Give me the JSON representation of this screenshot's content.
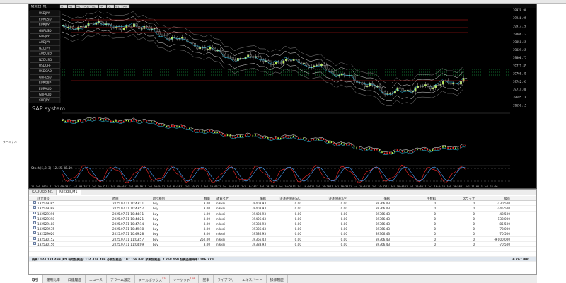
{
  "chart": {
    "window_title": "NIKKEI,M1",
    "toolbar_labels": [
      "M1",
      "M5",
      "M15",
      "M30",
      "H1",
      "H4",
      "D1",
      "W1",
      "MN"
    ],
    "symbols": [
      "USDJPY",
      "EURUSD",
      "EURJPY",
      "GBPUSD",
      "GBPJPY",
      "AUDJPY",
      "NZDJPY",
      "AUDUSD",
      "NZDUSD",
      "USDCHF",
      "USDCAD",
      "GBPUSD",
      "EURGBP",
      "EURAUD",
      "GBPAUD",
      "CHFJPY"
    ],
    "watermark": "SAP system",
    "price_labels": [
      "39970.90",
      "39946.95",
      "39917.20",
      "39886.12",
      "39858.55",
      "39829.65",
      "39800.75",
      "39771.85",
      "39760.45",
      "39742.93",
      "39714.00",
      "39685.10",
      "39656.15"
    ],
    "time_labels": [
      "11 Jul 2025",
      "11 Jul 09:34",
      "11 Jul 09:38",
      "11 Jul 09:42",
      "11 Jul 09:46",
      "11 Jul 09:50",
      "11 Jul 09:54",
      "11 Jul 09:58",
      "11 Jul 10:02",
      "11 Jul 10:06",
      "11 Jul 10:10",
      "11 Jul 10:14",
      "11 Jul 10:18",
      "11 Jul 10:22",
      "11 Jul 10:26",
      "11 Jul 10:30",
      "11 Jul 10:34",
      "11 Jul 10:38",
      "11 Jul 10:42",
      "11 Jul 10:46",
      "11 Jul 10:50",
      "11 Jul 10:54",
      "11 Jul 10:58",
      "11 Jul 11:02",
      "11 Jul 11:06"
    ],
    "stoch_label": "Stoch(5,3,3) 12.55 38.00"
  },
  "colors": {
    "bull": "#b6f04c",
    "bear": "#1a1a1a",
    "red_line": "#d21a1a",
    "green_dots": "#1fd15a",
    "cyan": "#33d8ff",
    "white_line": "#ffffff",
    "stoch_red": "#ff2a2a",
    "stoch_blue": "#4aa3ff"
  },
  "terminal": {
    "symbol_tabs": [
      "SAUUSD,M1",
      "NIKKEI,M1"
    ],
    "headers": [
      "注文番号",
      "時間",
      "取引種別",
      "数量",
      "通貨ペア",
      "価格",
      "決済逆指値(S/L)",
      "決済指値(T/P)",
      "価格",
      "手数料",
      "スワップ",
      "損益"
    ],
    "orders": [
      {
        "id": "132529385",
        "time": "2025.07.11 10:43:11",
        "type": "buy",
        "qty": "3.00",
        "symbol": "nikkei",
        "price": "39408.93",
        "sl": "0.00",
        "tp": "0.00",
        "cur": "39366.43",
        "fee": "0",
        "swap": "0",
        "profit": "-130 500"
      },
      {
        "id": "132529388",
        "time": "2025.07.11 10:43:52",
        "type": "buy",
        "qty": "3.00",
        "symbol": "nikkei",
        "price": "39408.93",
        "sl": "0.00",
        "tp": "0.00",
        "cur": "39366.43",
        "fee": "0",
        "swap": "0",
        "profit": "-145 500"
      },
      {
        "id": "132529396",
        "time": "2025.07.11 10:44:11",
        "type": "buy",
        "qty": "1.00",
        "symbol": "nikkei",
        "price": "39408.93",
        "sl": "0.00",
        "tp": "0.00",
        "cur": "39366.43",
        "fee": "0",
        "swap": "0",
        "profit": "-48 500"
      },
      {
        "id": "132529398",
        "time": "2025.07.11 10:44:21",
        "type": "buy",
        "qty": "3.00",
        "symbol": "nikkei",
        "price": "39406.43",
        "sl": "0.00",
        "tp": "0.00",
        "cur": "39366.43",
        "fee": "0",
        "swap": "0",
        "profit": "-138 000"
      },
      {
        "id": "132529488",
        "time": "2025.07.11 10:47:14",
        "type": "buy",
        "qty": "3.00",
        "symbol": "nikkei",
        "price": "39388.93",
        "sl": "0.00",
        "tp": "0.00",
        "cur": "39366.43",
        "fee": "0",
        "swap": "0",
        "profit": "-85 500"
      },
      {
        "id": "132529535",
        "time": "2025.07.11 10:49:18",
        "type": "buy",
        "qty": "3.00",
        "symbol": "nikkei",
        "price": "39386.43",
        "sl": "0.00",
        "tp": "0.00",
        "cur": "39366.43",
        "fee": "0",
        "swap": "0",
        "profit": "-78 000"
      },
      {
        "id": "132529626",
        "time": "2025.07.11 10:49:28",
        "type": "buy",
        "qty": "3.00",
        "symbol": "nikkei",
        "price": "39386.93",
        "sl": "0.00",
        "tp": "0.00",
        "cur": "39366.43",
        "fee": "0",
        "swap": "0",
        "profit": "-70 500"
      },
      {
        "id": "132530152",
        "time": "2025.07.11 11:03:57",
        "type": "buy",
        "qty": "250.00",
        "symbol": "nikkei",
        "price": "39366.43",
        "sl": "0.00",
        "tp": "0.00",
        "cur": "39366.43",
        "fee": "0",
        "swap": "0",
        "profit": "-9 000 000"
      },
      {
        "id": "132530156",
        "time": "2025.07.11 11:04:09",
        "type": "buy",
        "qty": "3.00",
        "symbol": "nikkei",
        "price": "39383.93",
        "sl": "0.00",
        "tp": "0.00",
        "cur": "39366.43",
        "fee": "0",
        "swap": "0",
        "profit": "-70 500"
      }
    ],
    "summary": "残高: 124 183 499 JPY  有効証拠金: 114 416 499  必要証拠金: 107 158 040  余剰証拠金: 7 258 459  証拠金維持率: 106.77%",
    "summary_total": "-9 767 000",
    "bottom_tabs": [
      {
        "label": "取引",
        "active": true
      },
      {
        "label": "運用比率",
        "active": false
      },
      {
        "label": "口座履歴",
        "active": false
      },
      {
        "label": "ニュース",
        "active": false
      },
      {
        "label": "アラーム設定",
        "active": false
      },
      {
        "label": "メールボックス",
        "badge": "53",
        "active": false
      },
      {
        "label": "マーケット",
        "badge": "108",
        "active": false
      },
      {
        "label": "記事",
        "active": false
      },
      {
        "label": "ライブラリ",
        "active": false
      },
      {
        "label": "エキスパート",
        "active": false
      },
      {
        "label": "操作履歴",
        "active": false
      }
    ],
    "side_label": "ターミナル"
  }
}
